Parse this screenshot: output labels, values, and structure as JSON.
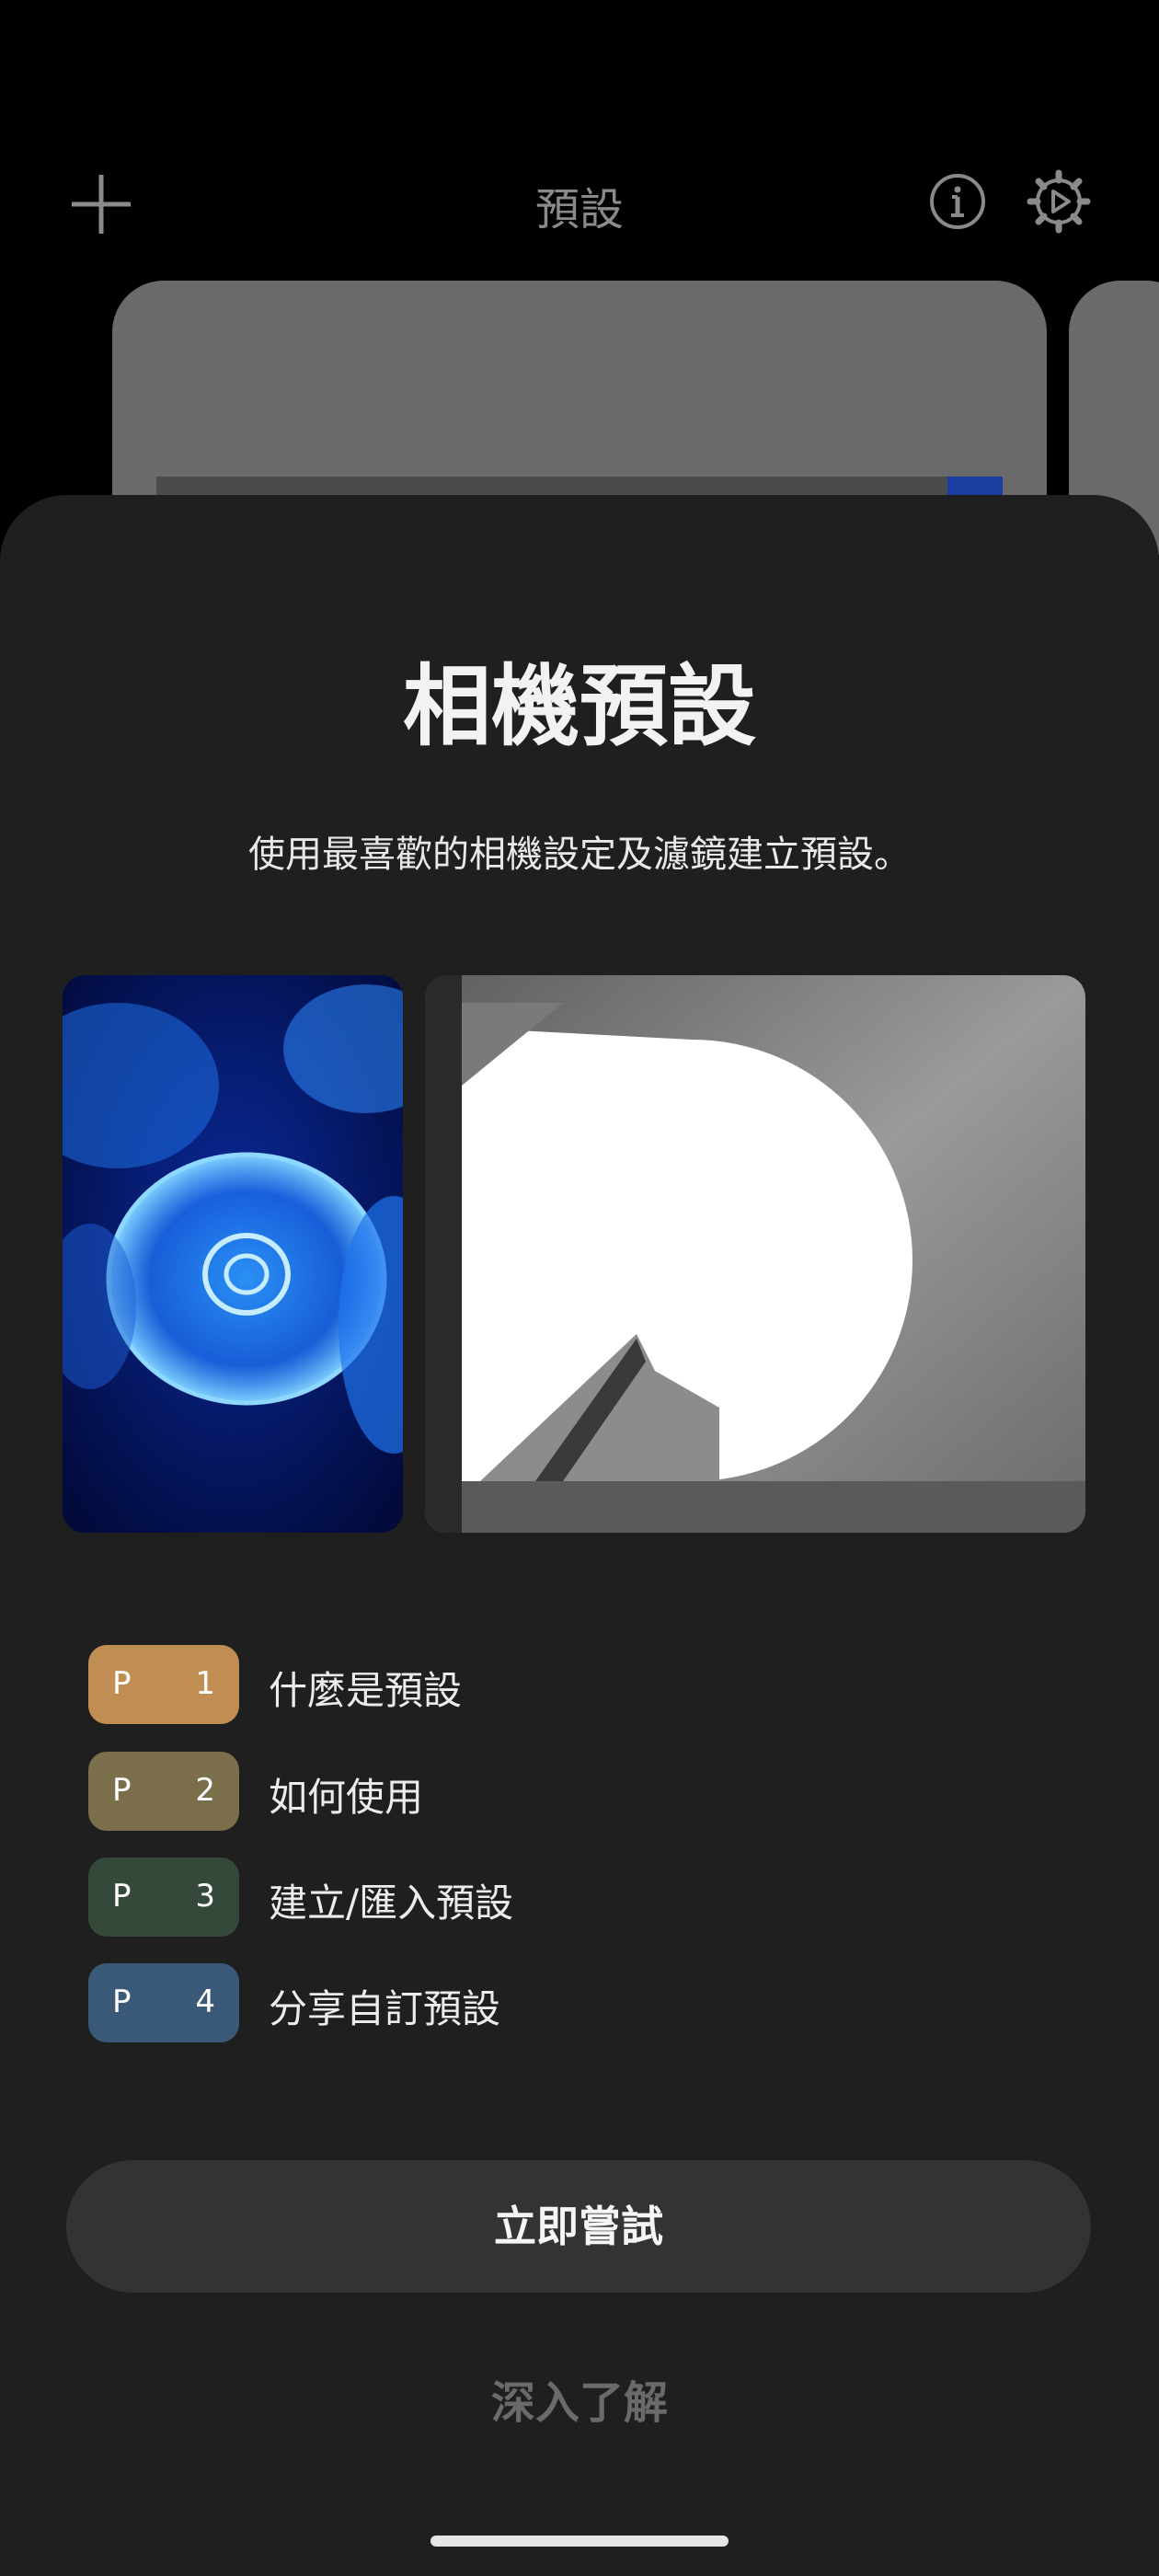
{
  "header": {
    "title": "預設",
    "add_icon": "plus-icon",
    "info_icon": "info-icon",
    "settings_icon": "gear-icon"
  },
  "sheet": {
    "title": "相機預設",
    "description": "使用最喜歡的相機設定及濾鏡建立預設。",
    "images": [
      "jellyfish-blue-photo",
      "building-bw-photo"
    ],
    "toc": [
      {
        "letter": "P",
        "num": "1",
        "label": "什麼是預設",
        "color": "#c08d52"
      },
      {
        "letter": "P",
        "num": "2",
        "label": "如何使用",
        "color": "#7b6e4b"
      },
      {
        "letter": "P",
        "num": "3",
        "label": "建立/匯入預設",
        "color": "#34493a"
      },
      {
        "letter": "P",
        "num": "4",
        "label": "分享自訂預設",
        "color": "#3a5878"
      }
    ],
    "primary_button": "立即嘗試",
    "secondary_link": "深入了解"
  },
  "colors": {
    "sheet_bg": "#1f1f1f",
    "button_bg": "#333333"
  }
}
